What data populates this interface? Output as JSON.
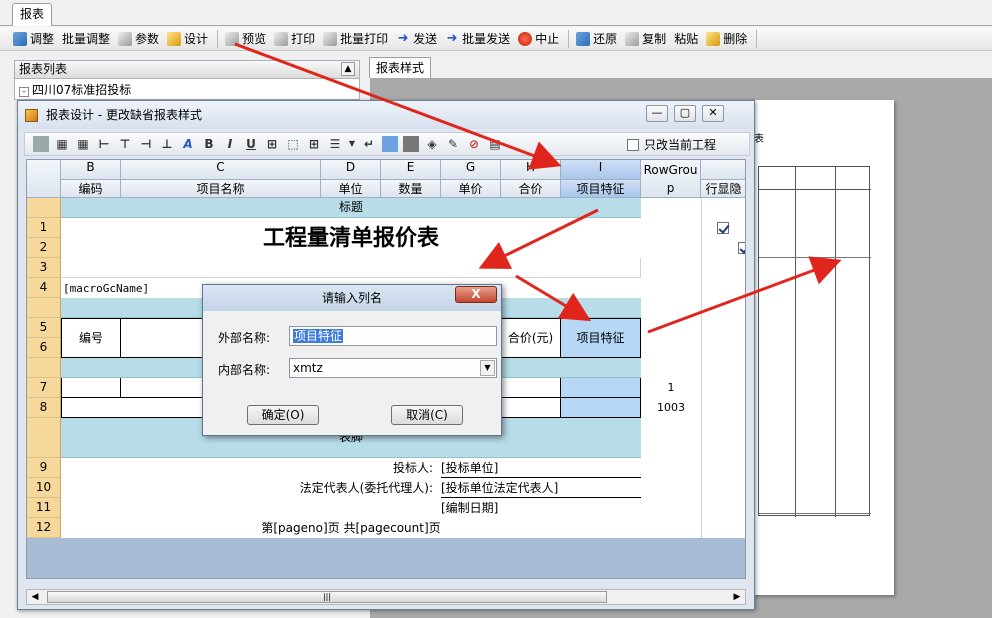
{
  "main_tab": "报表",
  "toolbar": [
    {
      "label": "调整",
      "icon": "adjust-icon"
    },
    {
      "label": "批量调整",
      "icon": ""
    },
    {
      "label": "参数",
      "icon": "params-icon"
    },
    {
      "label": "设计",
      "icon": "design-pencil-icon"
    },
    {
      "label": "预览",
      "icon": "preview-icon"
    },
    {
      "label": "打印",
      "icon": "print-icon"
    },
    {
      "label": "批量打印",
      "icon": "batch-print-icon"
    },
    {
      "label": "发送",
      "icon": "send-arrow-icon"
    },
    {
      "label": "批量发送",
      "icon": "batch-send-arrow-icon"
    },
    {
      "label": "中止",
      "icon": "stop-icon"
    },
    {
      "label": "还原",
      "icon": "restore-icon"
    },
    {
      "label": "复制",
      "icon": "copy-icon"
    },
    {
      "label": "粘贴",
      "icon": ""
    },
    {
      "label": "删除",
      "icon": "delete-icon"
    }
  ],
  "left_panel": {
    "title": "报表列表",
    "tree_item": "四川07标准招投标",
    "expander": "-"
  },
  "right_tab": "报表样式",
  "designer": {
    "title": "报表设计 - 更改缺省报表样式",
    "only_current_label": "只改当前工程",
    "only_current_checked": false,
    "col_letters": [
      "B",
      "C",
      "D",
      "E",
      "G",
      "H",
      "I",
      ""
    ],
    "col_names": [
      "编码",
      "项目名称",
      "单位",
      "数量",
      "单价",
      "合价",
      "项目特征",
      "RowGroup",
      "行显隐"
    ],
    "rows": [
      {
        "type": "band",
        "text": "标题"
      },
      {
        "num": "1",
        "title": "工程量清单报价表",
        "visible": true
      },
      {
        "num": "2",
        "visible": true
      },
      {
        "num": "3",
        "visible": true
      },
      {
        "num": "4",
        "macro": "[macroGcName]",
        "visible": true
      },
      {
        "type": "band",
        "text": ""
      },
      {
        "num": "5",
        "visible": true
      },
      {
        "num": "6",
        "visible": true
      },
      {
        "type": "band",
        "text": ""
      },
      {
        "num": "7",
        "rowgroup": "1",
        "visible": true
      },
      {
        "num": "8",
        "rowgroup": "1003",
        "visible": true
      },
      {
        "type": "band",
        "text": "表脚"
      },
      {
        "num": "9",
        "label": "投标人:",
        "value": "[投标单位]",
        "visible": true
      },
      {
        "num": "10",
        "label": "法定代表人(委托代理人):",
        "value": "[投标单位法定代表人]",
        "visible": true
      },
      {
        "num": "11",
        "value": "[编制日期]",
        "visible": true
      },
      {
        "num": "12",
        "text": "第[pageno]页 共[pagecount]页",
        "visible": true
      }
    ],
    "header_cells": {
      "code": "编号",
      "name_partial": "工程",
      "amount": "合价(元)",
      "feature": "项目特征"
    },
    "scroll_mid": "|||"
  },
  "dialog": {
    "title": "请输入列名",
    "close": "X",
    "outer_label": "外部名称:",
    "outer_value": "项目特征",
    "inner_label": "内部名称:",
    "inner_value": "xmtz",
    "ok": "确定(O)",
    "cancel": "取消(C)"
  },
  "colors": {
    "arrow": "#e0261c",
    "band": "#b8dde8",
    "rownum": "#f6d99a",
    "selected": "#b7d7f7"
  }
}
